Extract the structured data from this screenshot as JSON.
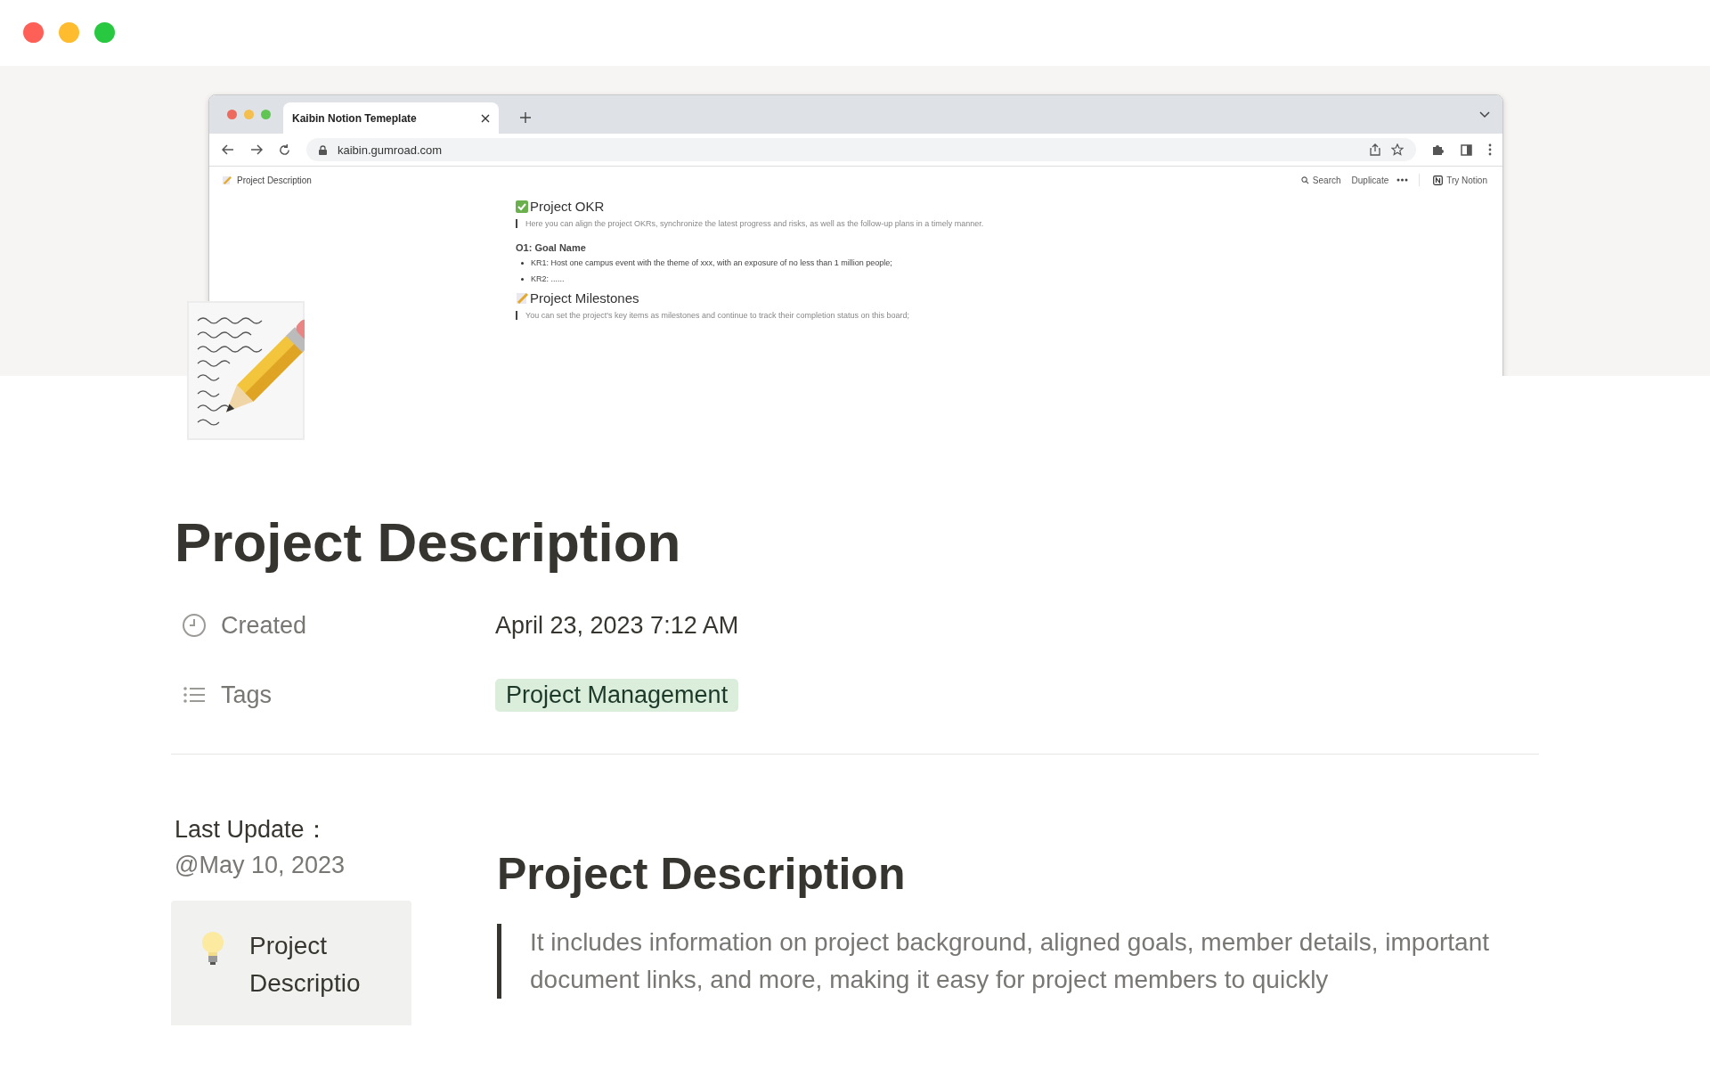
{
  "cover": {
    "browser": {
      "tab_title": "Kaibin Notion Temeplate",
      "url": "kaibin.gumroad.com",
      "breadcrumb": "Project Description",
      "actions": [
        "Search",
        "Duplicate"
      ],
      "try_button": "Try Notion",
      "blocks": [
        {
          "kind": "check-heading",
          "text": "Project OKR"
        },
        {
          "kind": "quote",
          "text": "Here you can align the project OKRs, synchronize the latest progress and risks, as well as the follow-up plans in a timely manner."
        },
        {
          "kind": "subheading",
          "text": "O1: Goal Name"
        },
        {
          "kind": "bullet",
          "text": "KR1: Host one campus event with the theme of xxx, with an exposure of no less than 1 million people;"
        },
        {
          "kind": "bullet",
          "text": "KR2: ......"
        },
        {
          "kind": "memo-heading",
          "text": "Project Milestones"
        },
        {
          "kind": "quote",
          "text": "You can set the project's key items as milestones and continue to track their completion status on this board;"
        }
      ]
    }
  },
  "page": {
    "title": "Project Description",
    "properties": [
      {
        "kind": "date",
        "label": "Created",
        "value": "April 23, 2023 7:12 AM"
      },
      {
        "kind": "tags",
        "label": "Tags",
        "value": "Project Management"
      }
    ]
  },
  "sidebar": {
    "label": "Last Update：",
    "value": "@May 10, 2023",
    "callout": "Project Descriptio"
  },
  "content": {
    "heading": "Project Description",
    "quote": "It includes information on project background, aligned goals, member details, important document links, and more, making it easy for project members to quickly"
  }
}
